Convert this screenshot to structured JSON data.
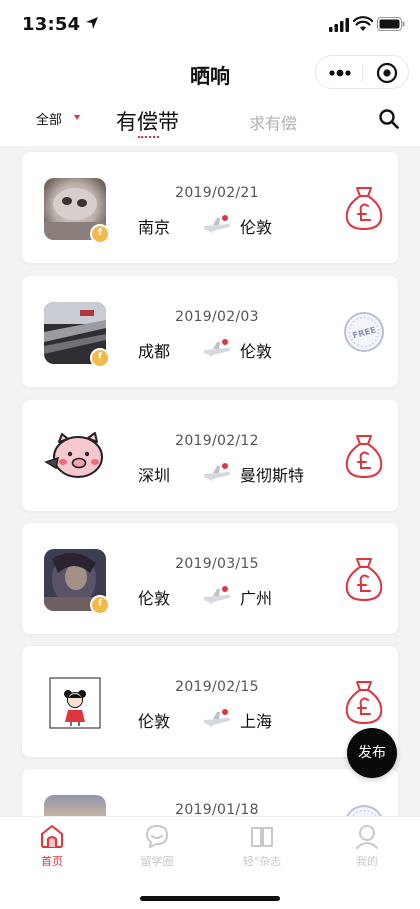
{
  "status_bar": {
    "time": "13:54"
  },
  "nav": {
    "title": "晒响"
  },
  "tabs": {
    "filter_label": "全部",
    "active_tab": "有偿带",
    "inactive_tab": "求有偿"
  },
  "colors": {
    "accent": "#e0343f",
    "coin": "#f3b94a",
    "fab": "#0a0a0a"
  },
  "cards": [
    {
      "date": "2019/02/21",
      "from": "南京",
      "to": "伦敦",
      "reward": "pound-bag-icon",
      "avatar": "blurry-cat-photo",
      "coin_badge": true
    },
    {
      "date": "2019/02/03",
      "from": "成都",
      "to": "伦敦",
      "reward": "free-coin-icon",
      "avatar": "city-street-photo",
      "coin_badge": true
    },
    {
      "date": "2019/02/12",
      "from": "深圳",
      "to": "曼彻斯特",
      "reward": "pound-bag-icon",
      "avatar": "pink-pig-sticker",
      "coin_badge": false
    },
    {
      "date": "2019/03/15",
      "from": "伦敦",
      "to": "广州",
      "reward": "pound-bag-icon",
      "avatar": "dark-portrait-photo",
      "coin_badge": true
    },
    {
      "date": "2019/02/15",
      "from": "伦敦",
      "to": "上海",
      "reward": "pound-bag-icon",
      "avatar": "girl-cartoon-drawing",
      "coin_badge": false
    },
    {
      "date": "2019/01/18",
      "from": "",
      "to": "",
      "reward": "free-coin-icon",
      "avatar": "sunset-photo",
      "coin_badge": false
    }
  ],
  "fab": {
    "label": "发布"
  },
  "tab_bar": [
    {
      "label": "首页",
      "icon": "home-icon",
      "active": true
    },
    {
      "label": "留学圈",
      "icon": "chat-bubble-icon",
      "active": false
    },
    {
      "label": "轻°杂志",
      "icon": "book-icon",
      "active": false
    },
    {
      "label": "我的",
      "icon": "user-icon",
      "active": false
    }
  ]
}
